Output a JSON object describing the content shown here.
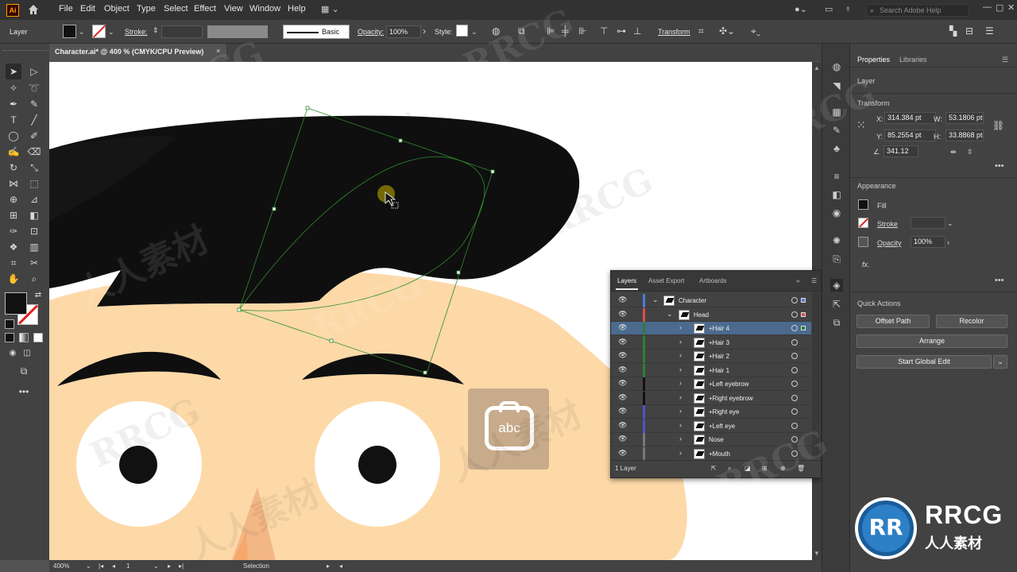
{
  "app": {
    "logo": "Ai"
  },
  "menu": [
    "File",
    "Edit",
    "Object",
    "Type",
    "Select",
    "Effect",
    "View",
    "Window",
    "Help"
  ],
  "search": {
    "placeholder": "Search Adobe Help"
  },
  "control": {
    "selection_label": "Layer",
    "stroke_label": "Stroke:",
    "brush_label": "Basic",
    "opacity_label": "Opacity:",
    "opacity_value": "100%",
    "style_label": "Style:",
    "transform_label": "Transform"
  },
  "document": {
    "tab_title": "Character.ai* @ 400 % (CMYK/CPU Preview)",
    "close": "×"
  },
  "status": {
    "zoom": "400%",
    "artboard": "1",
    "tool": "Selection"
  },
  "properties": {
    "tabs": [
      "Properties",
      "Libraries"
    ],
    "selection_type": "Layer",
    "transform_title": "Transform",
    "x_label": "X:",
    "x_value": "314.384 pt",
    "y_label": "Y:",
    "y_value": "85.2554 pt",
    "w_label": "W:",
    "w_value": "53.1806 pt",
    "h_label": "H:",
    "h_value": "33.8868 pt",
    "angle_value": "341.12",
    "appearance_title": "Appearance",
    "fill_label": "Fill",
    "stroke_label": "Stroke",
    "opacity_label": "Opacity",
    "opacity_value": "100%",
    "fx_label": "fx.",
    "quick_actions_title": "Quick Actions",
    "offset_path": "Offset Path",
    "recolor": "Recolor",
    "arrange": "Arrange",
    "global_edit": "Start Global Edit"
  },
  "layers": {
    "tabs": [
      "Layers",
      "Asset Export",
      "Artboards"
    ],
    "footer_count": "1 Layer",
    "rows": [
      {
        "name": "Character",
        "indent": 0,
        "expanded": true,
        "color": "#4f7bd9",
        "selected": false
      },
      {
        "name": "Head",
        "indent": 1,
        "expanded": true,
        "color": "#d94f4f",
        "selected": false
      },
      {
        "name": "+Hair 4",
        "indent": 2,
        "expanded": false,
        "color": "#2f7d3a",
        "selected": true
      },
      {
        "name": "+Hair 3",
        "indent": 2,
        "expanded": false,
        "color": "#2f7d3a",
        "selected": false
      },
      {
        "name": "+Hair 2",
        "indent": 2,
        "expanded": false,
        "color": "#2f7d3a",
        "selected": false
      },
      {
        "name": "+Hair 1",
        "indent": 2,
        "expanded": false,
        "color": "#2f7d3a",
        "selected": false
      },
      {
        "name": "+Left eyebrow",
        "indent": 2,
        "expanded": false,
        "color": "#111111",
        "selected": false
      },
      {
        "name": "+Right eyebrow",
        "indent": 2,
        "expanded": false,
        "color": "#111111",
        "selected": false
      },
      {
        "name": "+Right eye",
        "indent": 2,
        "expanded": false,
        "color": "#4a55c8",
        "selected": false
      },
      {
        "name": "+Left eye",
        "indent": 2,
        "expanded": false,
        "color": "#4a55c8",
        "selected": false
      },
      {
        "name": "Nose",
        "indent": 2,
        "expanded": false,
        "color": "#777777",
        "selected": false
      },
      {
        "name": "+Mouth",
        "indent": 2,
        "expanded": false,
        "color": "#777777",
        "selected": false
      }
    ]
  },
  "overlay": {
    "abc_text": "abc"
  },
  "watermark": {
    "brand": "RRCG",
    "brand_cn": "人人素材"
  },
  "colors": {
    "skin": "#fdd9a8",
    "hair": "#0f0f0f",
    "selection": "#2e8b2e",
    "accent": "#4b6a8e"
  }
}
